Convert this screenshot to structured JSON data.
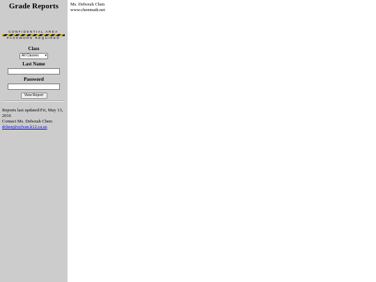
{
  "sidebar": {
    "title": "Grade Reports",
    "banner_top": "CONFIDENTIAL AREA",
    "banner_bottom": "PASSWORD REQUIRED",
    "form": {
      "class_label": "Class",
      "class_value": "All Classes",
      "lastname_label": "Last Name",
      "lastname_value": "",
      "password_label": "Password",
      "password_value": "",
      "submit_label": "View Report"
    },
    "info": {
      "updated_label": "Reports last updated:",
      "updated_value": "Fri, May 13, 2016",
      "contact_label": "Contact Ms. Deborah Chen:",
      "email": "dchen@sylvan.k12.ca.us"
    },
    "colors": {
      "background": "#cccccc",
      "link": "#0000ee",
      "stripe_dark": "#222222",
      "stripe_light": "#d9b000"
    }
  },
  "header": {
    "name": "Ms. Deborah Chen",
    "site": "www.chenmath.net"
  }
}
